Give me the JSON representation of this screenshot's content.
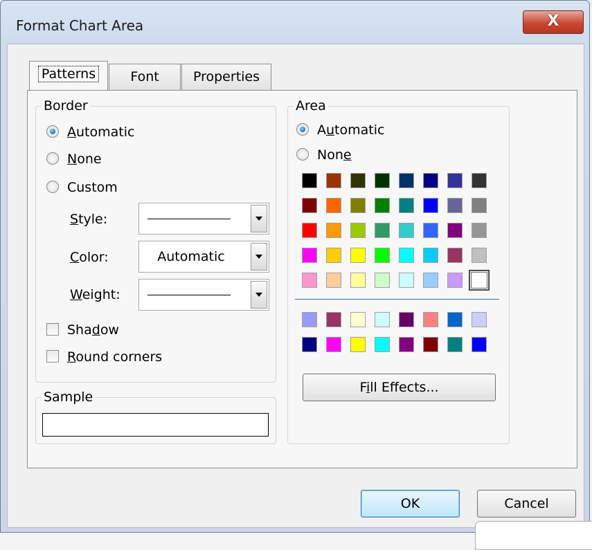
{
  "window": {
    "title": "Format Chart Area",
    "close_label": "X"
  },
  "tabs": [
    {
      "label": "Patterns",
      "active": true
    },
    {
      "label": "Font",
      "active": false
    },
    {
      "label": "Properties",
      "active": false
    }
  ],
  "border": {
    "group_label": "Border",
    "options": [
      {
        "label": "Automatic",
        "checked": true
      },
      {
        "label": "None",
        "checked": false
      },
      {
        "label": "Custom",
        "checked": false
      }
    ],
    "style_label": "Style:",
    "color_label": "Color:",
    "color_value": "Automatic",
    "weight_label": "Weight:",
    "shadow_label": "Shadow",
    "shadow_checked": false,
    "round_corners_label": "Round corners",
    "round_corners_checked": false
  },
  "sample": {
    "group_label": "Sample"
  },
  "area": {
    "group_label": "Area",
    "options": [
      {
        "label": "Automatic",
        "checked": true
      },
      {
        "label": "None",
        "checked": false
      }
    ],
    "palette_rows": [
      [
        "#000000",
        "#993300",
        "#333300",
        "#003300",
        "#003366",
        "#000080",
        "#333399",
        "#333333"
      ],
      [
        "#800000",
        "#ff6600",
        "#808000",
        "#008000",
        "#008080",
        "#0000ff",
        "#666699",
        "#808080"
      ],
      [
        "#ff0000",
        "#ff9900",
        "#99cc00",
        "#339966",
        "#33cccc",
        "#3366ff",
        "#800080",
        "#969696"
      ],
      [
        "#ff00ff",
        "#ffcc00",
        "#ffff00",
        "#00ff00",
        "#00ffff",
        "#00ccff",
        "#993366",
        "#c0c0c0"
      ],
      [
        "#ff99cc",
        "#ffcc99",
        "#ffff99",
        "#ccffcc",
        "#ccffff",
        "#99ccff",
        "#cc99ff",
        "#ffffff"
      ]
    ],
    "chart_palette_rows": [
      [
        "#9999ff",
        "#993366",
        "#ffffcc",
        "#ccffff",
        "#660066",
        "#ff8080",
        "#0066cc",
        "#ccccff"
      ],
      [
        "#000080",
        "#ff00ff",
        "#ffff00",
        "#00ffff",
        "#800080",
        "#800000",
        "#008080",
        "#0000ff"
      ]
    ],
    "selected_swatch": "#ffffff",
    "fill_effects_label": "Fill Effects..."
  },
  "buttons": {
    "ok_label": "OK",
    "cancel_label": "Cancel"
  }
}
